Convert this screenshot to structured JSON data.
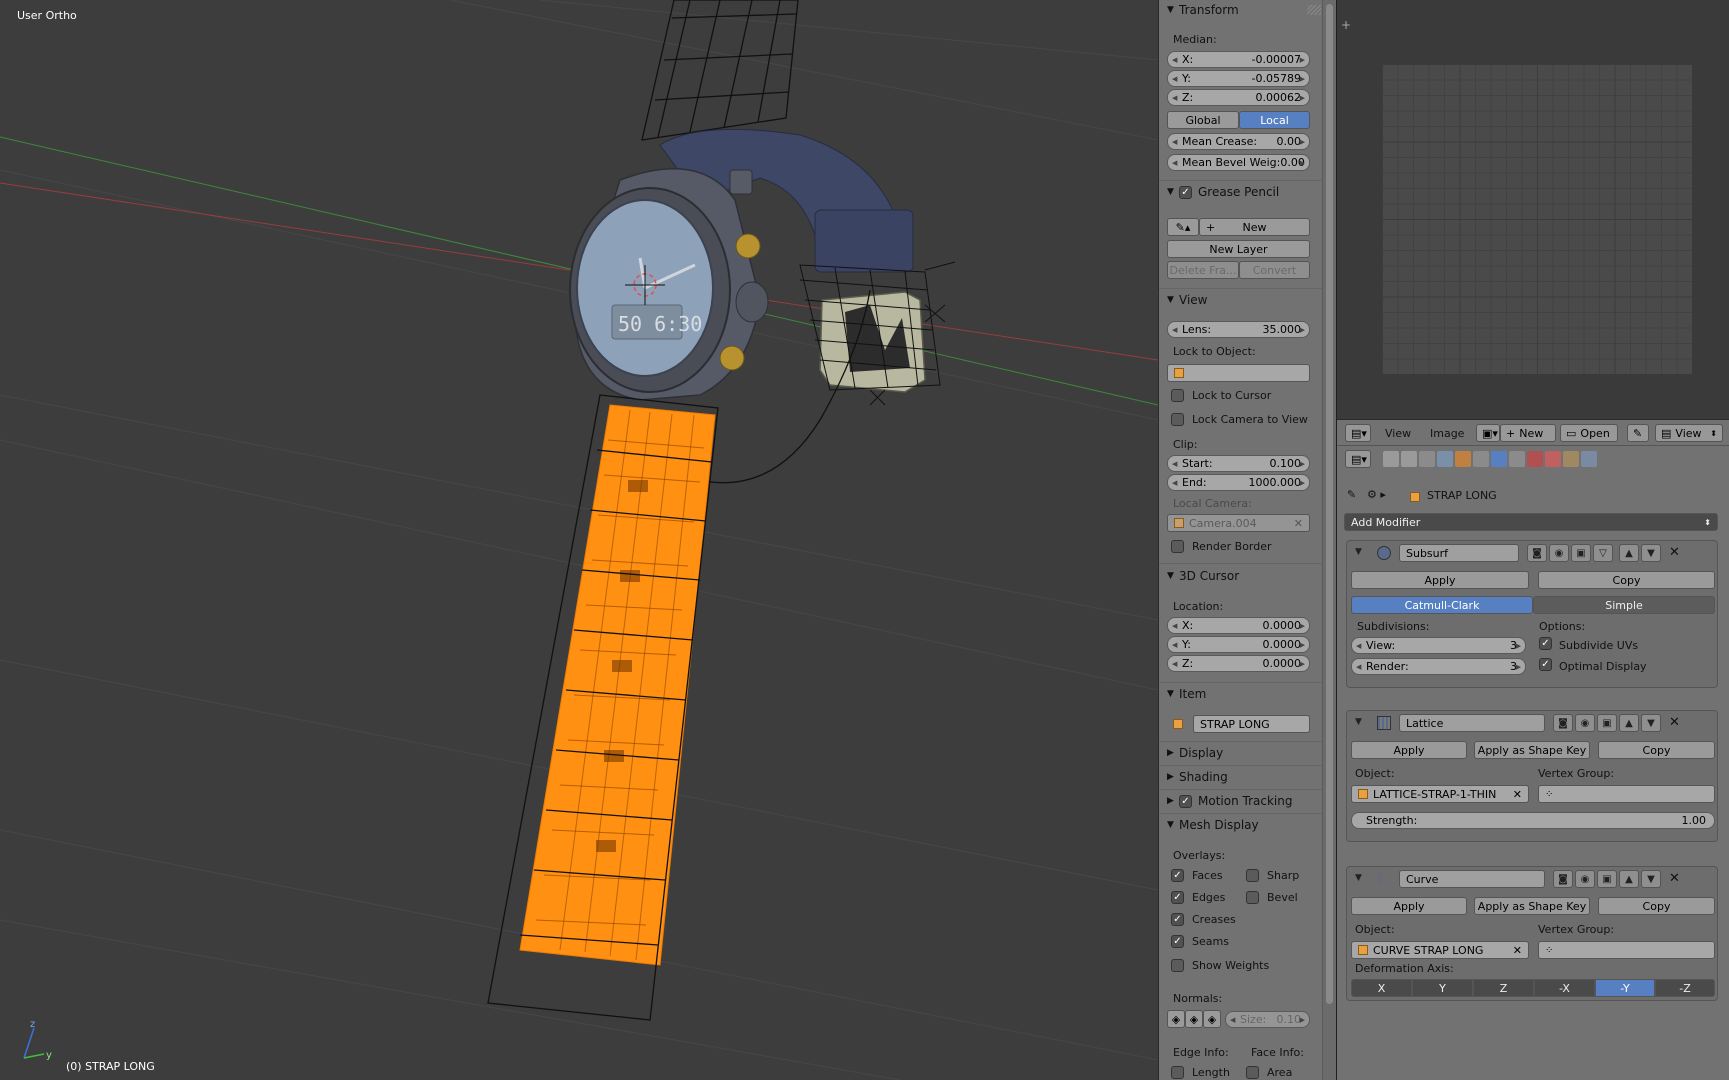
{
  "viewport": {
    "view_name": "User Ortho",
    "object_status": "(0) STRAP LONG",
    "axis_z": "z",
    "axis_y": "y",
    "watch_digits": "50 6:30"
  },
  "npanel": {
    "transform": {
      "title": "Transform",
      "median_label": "Median:",
      "x_key": "X:",
      "x_val": "-0.00007",
      "y_key": "Y:",
      "y_val": "-0.05789",
      "z_key": "Z:",
      "z_val": "0.00062",
      "global": "Global",
      "local": "Local",
      "crease_key": "Mean Crease:",
      "crease_val": "0.00",
      "bevel_key": "Mean Bevel Weig:",
      "bevel_val": "0.00"
    },
    "grease_pencil": {
      "title": "Grease Pencil",
      "new": "New",
      "new_layer": "New Layer",
      "delete_frame": "Delete Fra...",
      "convert": "Convert"
    },
    "view": {
      "title": "View",
      "lens_key": "Lens:",
      "lens_val": "35.000",
      "lock_to_object": "Lock to Object:",
      "lock_to_cursor": "Lock to Cursor",
      "lock_camera": "Lock Camera to View",
      "clip": "Clip:",
      "start_key": "Start:",
      "start_val": "0.100",
      "end_key": "End:",
      "end_val": "1000.000",
      "local_camera": "Local Camera:",
      "camera_name": "Camera.004",
      "render_border": "Render Border"
    },
    "cursor": {
      "title": "3D Cursor",
      "location": "Location:",
      "x_key": "X:",
      "x_val": "0.0000",
      "y_key": "Y:",
      "y_val": "0.0000",
      "z_key": "Z:",
      "z_val": "0.0000"
    },
    "item": {
      "title": "Item",
      "name": "STRAP LONG"
    },
    "display": "Display",
    "shading": "Shading",
    "motion_tracking": "Motion Tracking",
    "mesh_display": {
      "title": "Mesh Display",
      "overlays": "Overlays:",
      "faces": "Faces",
      "sharp": "Sharp",
      "edges": "Edges",
      "bevel": "Bevel",
      "creases": "Creases",
      "seams": "Seams",
      "show_weights": "Show Weights",
      "normals": "Normals:",
      "size_key": "Size:",
      "size_val": "0.10",
      "edge_info": "Edge Info:",
      "face_info": "Face Info:",
      "length": "Length",
      "area": "Area"
    }
  },
  "uv_header": {
    "view": "View",
    "image": "Image",
    "new": "New",
    "open": "Open",
    "view_mode": "View"
  },
  "properties": {
    "object_name": "STRAP LONG",
    "add_modifier": "Add Modifier",
    "subsurf": {
      "name": "Subsurf",
      "apply": "Apply",
      "copy": "Copy",
      "catmull": "Catmull-Clark",
      "simple": "Simple",
      "subdivisions": "Subdivisions:",
      "options": "Options:",
      "view_key": "View:",
      "view_val": "3",
      "render_key": "Render:",
      "render_val": "3",
      "subdivide_uvs": "Subdivide UVs",
      "optimal_display": "Optimal Display"
    },
    "lattice": {
      "name": "Lattice",
      "apply": "Apply",
      "apply_shape": "Apply as Shape Key",
      "copy": "Copy",
      "object_label": "Object:",
      "vgroup_label": "Vertex Group:",
      "object": "LATTICE-STRAP-1-THIN",
      "strength_key": "Strength:",
      "strength_val": "1.00"
    },
    "curve": {
      "name": "Curve",
      "apply": "Apply",
      "apply_shape": "Apply as Shape Key",
      "copy": "Copy",
      "object_label": "Object:",
      "vgroup_label": "Vertex Group:",
      "object": "CURVE STRAP LONG",
      "deform_axis": "Deformation Axis:",
      "axes": [
        "X",
        "Y",
        "Z",
        "-X",
        "-Y",
        "-Z"
      ]
    }
  },
  "colors": {
    "viewport_bg": "#3d3d3d",
    "panel_bg": "#727272",
    "accent_blue": "#5680c2",
    "selection_orange": "#ff8c00"
  }
}
